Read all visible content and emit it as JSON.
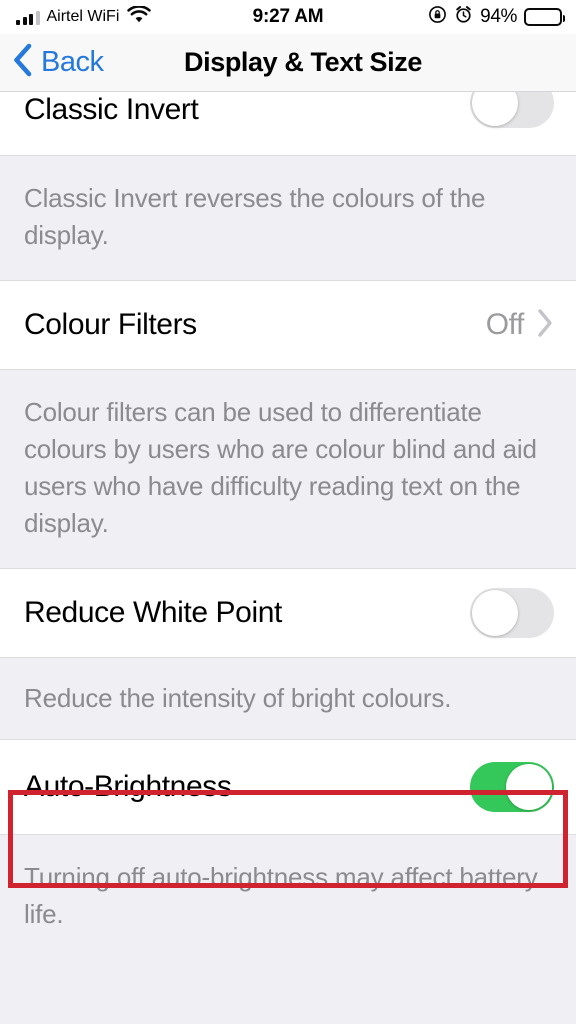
{
  "status_bar": {
    "carrier": "Airtel WiFi",
    "signal_icon": "signal-bars-icon",
    "wifi_icon": "wifi-icon",
    "time": "9:27 AM",
    "rotation_lock_icon": "rotation-lock-icon",
    "alarm_icon": "alarm-clock-icon",
    "battery_percent": "94%",
    "battery_icon": "battery-icon",
    "battery_level": 94
  },
  "nav_bar": {
    "back_label": "Back",
    "back_icon": "chevron-left-icon",
    "title": "Display & Text Size",
    "accent_color": "#2579dd"
  },
  "settings": {
    "rows": [
      {
        "label": "Classic Invert",
        "control": "toggle",
        "value": "off",
        "footnote": "Classic Invert reverses the colours of the display."
      },
      {
        "label": "Colour Filters",
        "control": "disclosure",
        "value": "Off",
        "chevron_icon": "chevron-right-icon",
        "footnote": "Colour filters can be used to differentiate colours by users who are colour blind and aid users who have difficulty reading text on the display."
      },
      {
        "label": "Reduce White Point",
        "control": "toggle",
        "value": "off",
        "footnote": "Reduce the intensity of bright colours."
      },
      {
        "label": "Auto-Brightness",
        "control": "toggle",
        "value": "on",
        "footnote": "Turning off auto-brightness may affect battery life."
      }
    ]
  },
  "annotation": {
    "type": "highlight-rectangle",
    "target": "Auto-Brightness",
    "color": "#cf2330"
  },
  "colors": {
    "toggle_on": "#34c759",
    "toggle_off": "#e4e4e6",
    "group_background": "#f0f0f4",
    "row_background": "#ffffff",
    "secondary_text": "#8a8a8f"
  }
}
